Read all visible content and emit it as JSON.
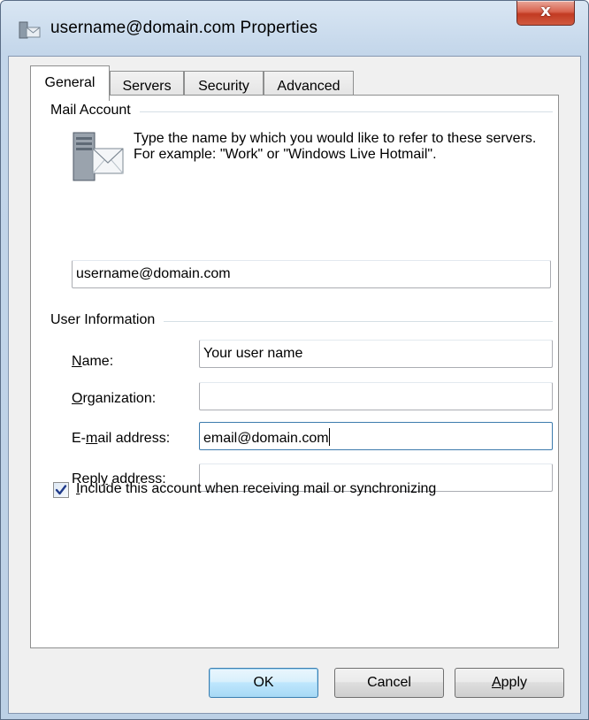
{
  "window": {
    "title": "username@domain.com Properties",
    "close_glyph": "x"
  },
  "tabs": [
    {
      "label": "General",
      "active": true
    },
    {
      "label": "Servers",
      "active": false
    },
    {
      "label": "Security",
      "active": false
    },
    {
      "label": "Advanced",
      "active": false
    }
  ],
  "mail_account": {
    "group_label": "Mail Account",
    "description": "Type the name by which you would like to refer to these servers.  For example: \"Work\" or \"Windows Live Hotmail\".",
    "account_name_value": "username@domain.com",
    "icon": "mail-server-icon"
  },
  "user_information": {
    "group_label": "User Information",
    "fields": [
      {
        "label_pre": "",
        "label_key": "N",
        "label_post": "ame:",
        "value": ""
      },
      {
        "label_pre": "",
        "label_key": "O",
        "label_post": "rganization:",
        "value": ""
      },
      {
        "label_pre": "E-",
        "label_key": "m",
        "label_post": "ail address:",
        "value": ""
      },
      {
        "label_pre": "Repl",
        "label_key": "y",
        "label_post": " address:",
        "value": ""
      }
    ],
    "name_value": "Your user name",
    "organization_value": "",
    "email_value": "email@domain.com",
    "reply_value": ""
  },
  "include_checkbox": {
    "checked": true,
    "label_key": "I",
    "label_rest": "nclude this account when receiving mail or synchronizing"
  },
  "buttons": {
    "ok": "OK",
    "cancel": "Cancel",
    "apply_key": "A",
    "apply_rest": "pply"
  },
  "colors": {
    "titlebar": "#c3d6ea",
    "close_button": "#c23a22",
    "default_button": "#bee6fd",
    "focus_border": "#3d7bad"
  }
}
